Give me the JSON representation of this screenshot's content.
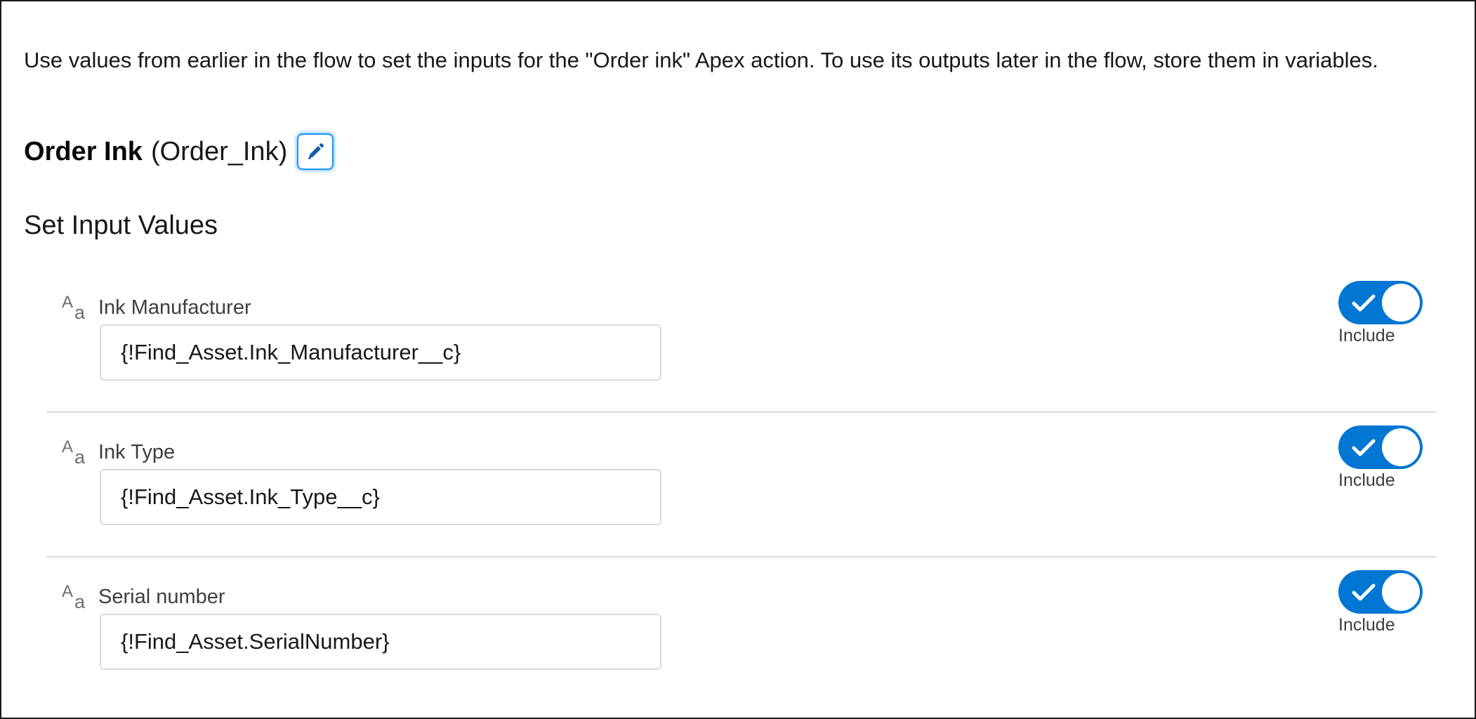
{
  "description": "Use values from earlier in the flow to set the inputs for the \"Order ink\" Apex action. To use its outputs later in the flow, store them in variables.",
  "action": {
    "label": "Order Ink",
    "api_name": "(Order_Ink)",
    "edit_icon": "pencil-icon"
  },
  "section_title": "Set Input Values",
  "inputs": [
    {
      "type_icon": "text-type-icon",
      "type_glyph_upper": "A",
      "type_glyph_lower": "a",
      "label": "Ink Manufacturer",
      "value": "{!Find_Asset.Ink_Manufacturer__c}",
      "include_label": "Include",
      "included": true
    },
    {
      "type_icon": "text-type-icon",
      "type_glyph_upper": "A",
      "type_glyph_lower": "a",
      "label": "Ink Type",
      "value": "{!Find_Asset.Ink_Type__c}",
      "include_label": "Include",
      "included": true
    },
    {
      "type_icon": "text-type-icon",
      "type_glyph_upper": "A",
      "type_glyph_lower": "a",
      "label": "Serial number",
      "value": "{!Find_Asset.SerialNumber}",
      "include_label": "Include",
      "included": true
    }
  ],
  "colors": {
    "toggle_on": "#0176d3",
    "focus_ring": "#1b96ff",
    "pencil": "#0b5cab",
    "divider": "#dddbda"
  }
}
